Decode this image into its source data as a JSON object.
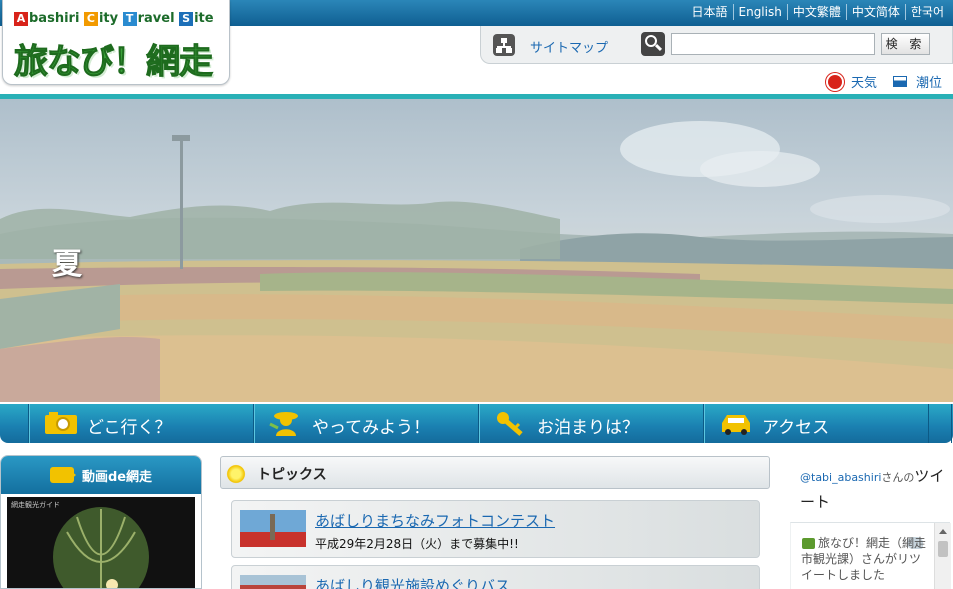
{
  "header": {
    "languages": [
      "日本語",
      "English",
      "中文繁體",
      "中文简体",
      "한국어"
    ],
    "logo_en": [
      {
        "cap": "A",
        "rest": "bashiri ",
        "color": "#d8231a"
      },
      {
        "cap": "C",
        "rest": "ity ",
        "color": "#f29a00"
      },
      {
        "cap": "T",
        "rest": "ravel ",
        "color": "#2a8bd0"
      },
      {
        "cap": "S",
        "rest": "ite",
        "color": "#1c6fb8"
      }
    ],
    "logo_jp": "旅なび！網走",
    "sitemap_label": "サイトマップ",
    "search_value": "",
    "search_button": "検 索",
    "weather_label": "天気",
    "tide_label": "潮位"
  },
  "hero": {
    "season_label": "夏"
  },
  "nav": [
    {
      "label": "どこ行く？",
      "icon": "camera-icon"
    },
    {
      "label": "やってみよう！",
      "icon": "person-icon"
    },
    {
      "label": "お泊まりは？",
      "icon": "key-icon"
    },
    {
      "label": "アクセス",
      "icon": "car-icon"
    }
  ],
  "video": {
    "heading": "動画de網走",
    "frame_caption": "網走観光ガイド"
  },
  "topics": {
    "heading": "トピックス",
    "items": [
      {
        "title": "あばしりまちなみフォトコンテスト",
        "subtitle": "平成29年2月28日（火）まで募集中!!"
      },
      {
        "title": "あばしり観光施設めぐりバス",
        "subtitle": ""
      }
    ]
  },
  "twitter": {
    "handle": "@tabi_abashiri",
    "suffix_small": "さんの",
    "suffix_large": "ツイート",
    "retweet_text": "旅なび！網走（網走市観光課）さんがリツイートしました"
  },
  "colors": {
    "header_blue": "#0f5f92",
    "accent_teal": "#29b0b6",
    "link_blue": "#1a68b1",
    "logo_green": "#3aa23a"
  }
}
